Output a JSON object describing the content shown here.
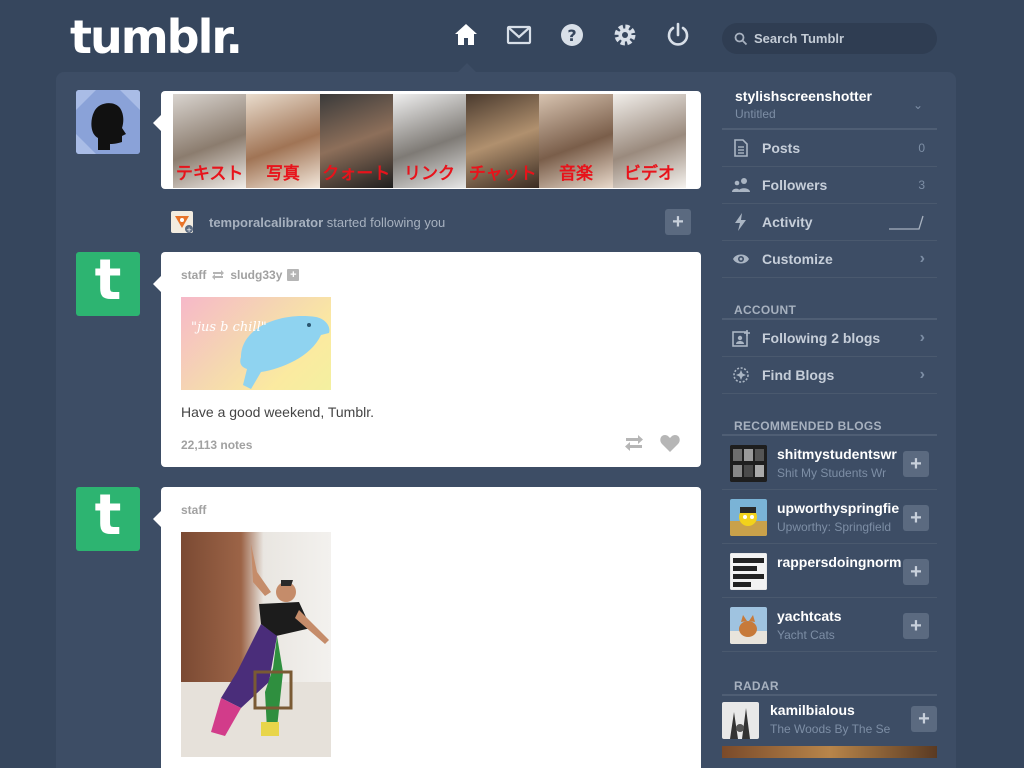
{
  "header": {
    "logo": "tumblr.",
    "nav": [
      {
        "name": "home-icon"
      },
      {
        "name": "inbox-icon"
      },
      {
        "name": "help-icon"
      },
      {
        "name": "settings-icon"
      },
      {
        "name": "power-icon"
      }
    ],
    "search_placeholder": "Search Tumblr"
  },
  "dashboard": {
    "banner_tiles": [
      "テキスト",
      "写真",
      "クォート",
      "リンク",
      "チャット",
      "音楽",
      "ビデオ"
    ],
    "follow_notice": {
      "user": "temporalcalibrator",
      "text": " started following you"
    },
    "posts": [
      {
        "author": "staff",
        "reblogged_from": "sludg33y",
        "image_text": "\"jus b chill\"",
        "caption": "Have a good weekend, Tumblr.",
        "notes": "22,113 notes"
      },
      {
        "author": "staff"
      }
    ]
  },
  "sidebar": {
    "blog": {
      "name": "stylishscreenshotter",
      "title": "Untitled"
    },
    "stats": [
      {
        "label": "Posts",
        "value": "0",
        "icon": "posts-icon"
      },
      {
        "label": "Followers",
        "value": "3",
        "icon": "followers-icon"
      },
      {
        "label": "Activity",
        "icon": "activity-icon"
      },
      {
        "label": "Customize",
        "icon": "eye-icon"
      }
    ],
    "account_label": "ACCOUNT",
    "account": [
      {
        "label": "Following 2 blogs",
        "icon": "following-icon"
      },
      {
        "label": "Find Blogs",
        "icon": "find-blogs-icon"
      }
    ],
    "recommended_label": "RECOMMENDED BLOGS",
    "recommended": [
      {
        "name": "shitmystudentswr",
        "title": "Shit My Students Wr"
      },
      {
        "name": "upworthyspringfie",
        "title": "Upworthy: Springfield"
      },
      {
        "name": "rappersdoingnorm",
        "title": ""
      },
      {
        "name": "yachtcats",
        "title": "Yacht Cats"
      }
    ],
    "radar_label": "RADAR",
    "radar": {
      "name": "kamilbialous",
      "title": "The Woods By The Se"
    }
  },
  "colors": {
    "background": "#36465d",
    "panel": "#3d4d65",
    "staff_green": "#2db471",
    "banner_red": "#e8131b"
  }
}
